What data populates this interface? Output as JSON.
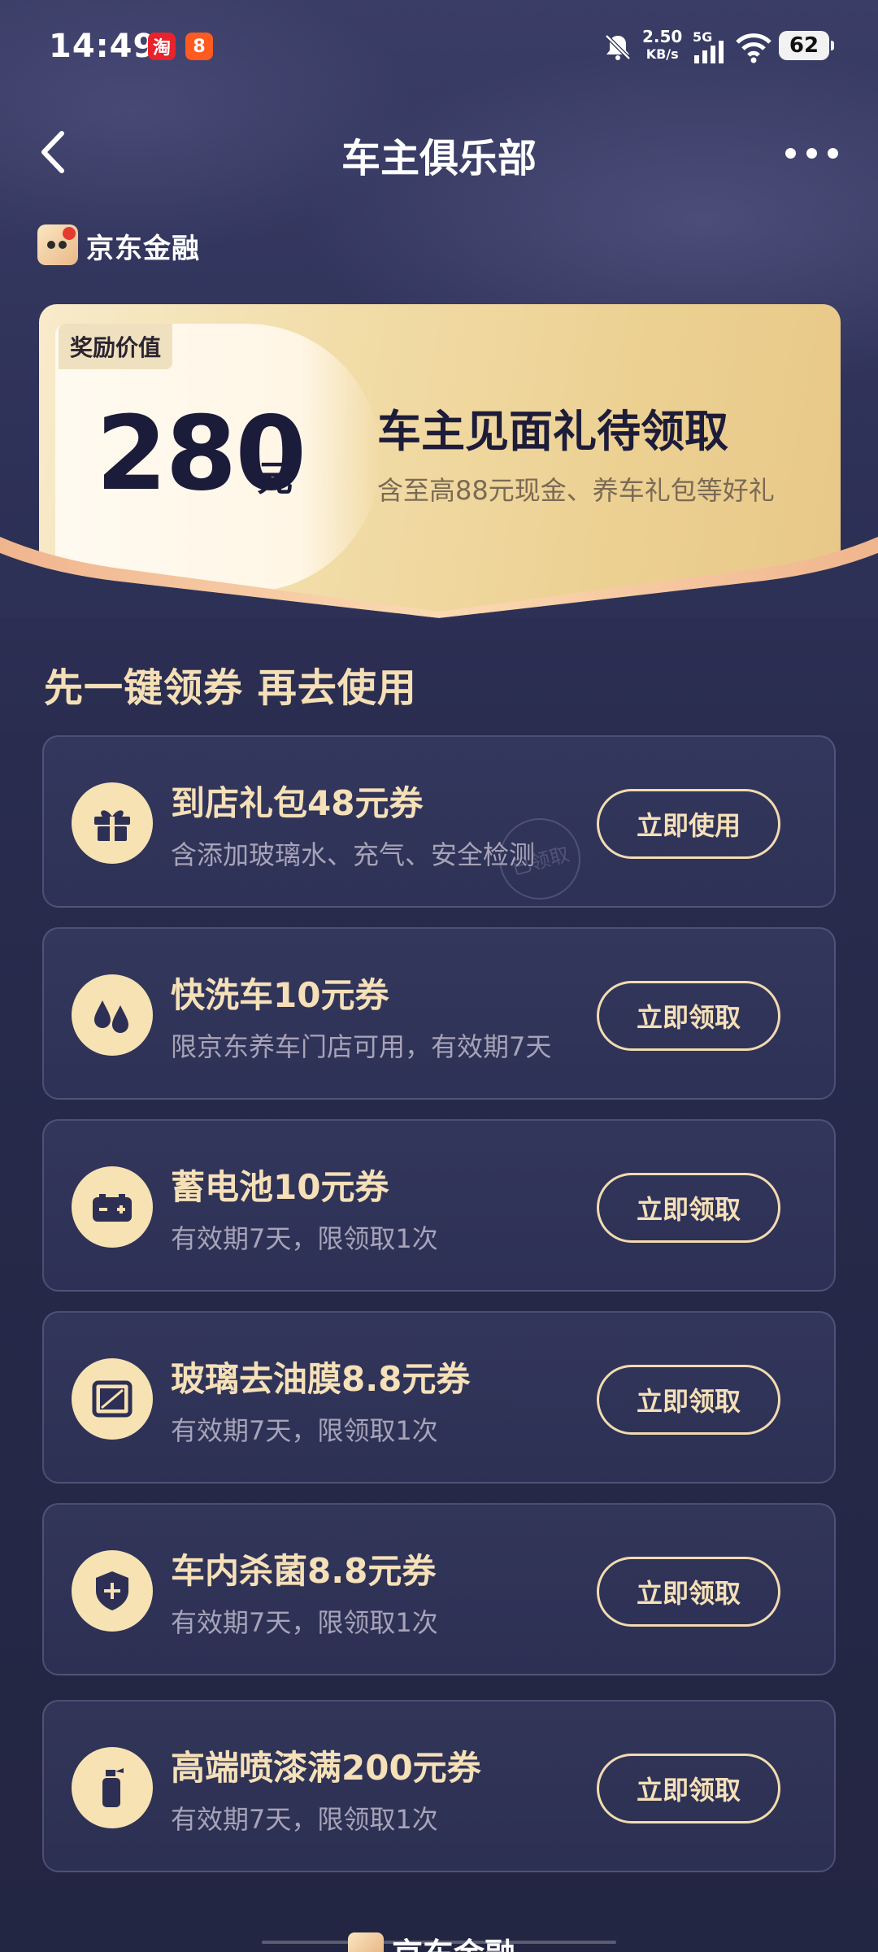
{
  "status_bar": {
    "time": "14:49",
    "app1": "淘",
    "app2": "8",
    "net_speed": "2.50",
    "net_unit": "KB/s",
    "signal_label": "5G",
    "battery": "62"
  },
  "header": {
    "title": "车主俱乐部"
  },
  "brand": {
    "name": "京东金融"
  },
  "reward": {
    "tag": "奖励价值",
    "amount": "280",
    "unit": "元",
    "title": "车主见面礼待领取",
    "subtitle": "含至高88元现金、养车礼包等好礼"
  },
  "section": {
    "title": "先一键领券 再去使用"
  },
  "coupons": [
    {
      "title": "到店礼包48元券",
      "desc": "含添加玻璃水、充气、安全检测",
      "button": "立即使用",
      "stamp": "已领取",
      "icon": "gift-icon"
    },
    {
      "title": "快洗车10元券",
      "desc": "限京东养车门店可用，有效期7天",
      "button": "立即领取",
      "icon": "water-drops-icon"
    },
    {
      "title": "蓄电池10元券",
      "desc": "有效期7天，限领取1次",
      "button": "立即领取",
      "icon": "battery-icon"
    },
    {
      "title": "玻璃去油膜8.8元券",
      "desc": "有效期7天，限领取1次",
      "button": "立即领取",
      "icon": "windshield-icon"
    },
    {
      "title": "车内杀菌8.8元券",
      "desc": "有效期7天，限领取1次",
      "button": "立即领取",
      "icon": "shield-plus-icon"
    },
    {
      "title": "高端喷漆满200元券",
      "desc": "有效期7天，限领取1次",
      "button": "立即领取",
      "icon": "spray-can-icon"
    }
  ],
  "footer": {
    "brand": "京东金融"
  }
}
